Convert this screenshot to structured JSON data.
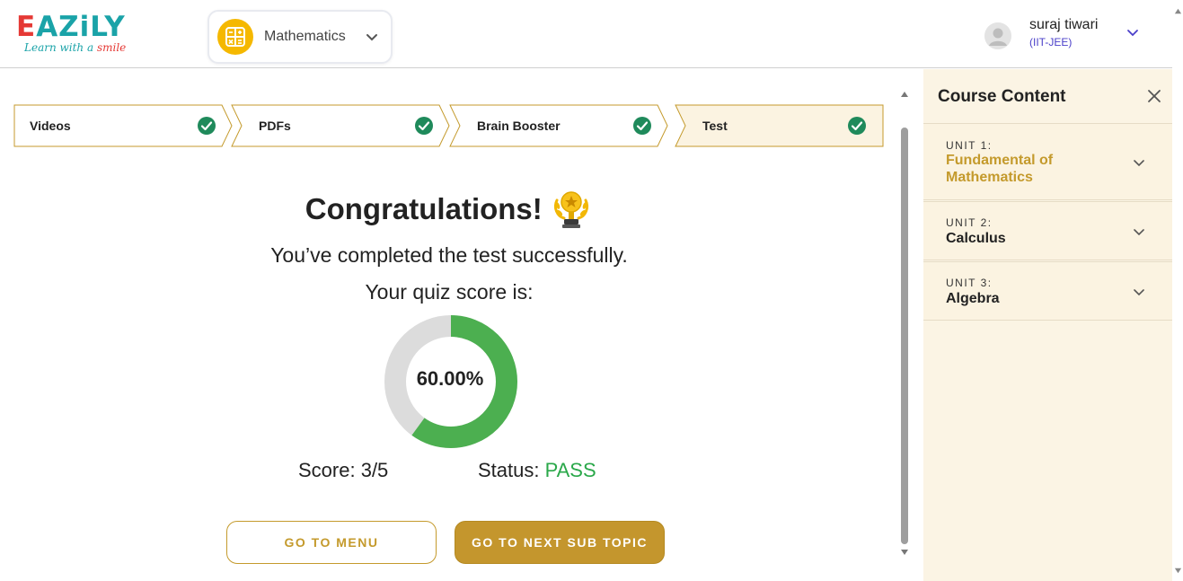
{
  "header": {
    "logo": {
      "letter_e": "E",
      "letters_rest": "AZiLY",
      "tagline_prefix": "Learn with a ",
      "tagline_highlight": "smile"
    },
    "subject": {
      "label": "Mathematics",
      "icon": "calculator-icon"
    },
    "user": {
      "name": "suraj tiwari",
      "role": "(IIT-JEE)",
      "avatar_icon": "user-avatar-icon"
    }
  },
  "steps": [
    {
      "label": "Videos",
      "completed": true
    },
    {
      "label": "PDFs",
      "completed": true
    },
    {
      "label": "Brain Booster",
      "completed": true
    },
    {
      "label": "Test",
      "completed": true,
      "active": true
    }
  ],
  "result": {
    "heading": "Congratulations!",
    "trophy_icon": "trophy-icon",
    "subtitle": "You’ve completed the test successfully.",
    "score_label": "Your quiz score is:",
    "percent_text": "60.00%",
    "percent_value": 60,
    "score_prefix": "Score: ",
    "score_value": "3/5",
    "status_prefix": "Status: ",
    "status_value": "PASS"
  },
  "buttons": {
    "menu": "GO TO MENU",
    "next": "GO TO NEXT SUB TOPIC"
  },
  "sidebar": {
    "title": "Course Content",
    "units": [
      {
        "code": "UNIT 1:",
        "title": "Fundamental of Mathematics",
        "active": true
      },
      {
        "code": "UNIT 2:",
        "title": "Calculus",
        "active": false
      },
      {
        "code": "UNIT 3:",
        "title": "Algebra",
        "active": false
      }
    ]
  },
  "colors": {
    "accent_gold": "#c49a2c",
    "pass_green": "#2aa84a",
    "donut_green": "#4caf50",
    "donut_gray": "#dcdcdc",
    "check_teal": "#1f8a5b",
    "sidebar_bg": "#fbf4e4"
  }
}
